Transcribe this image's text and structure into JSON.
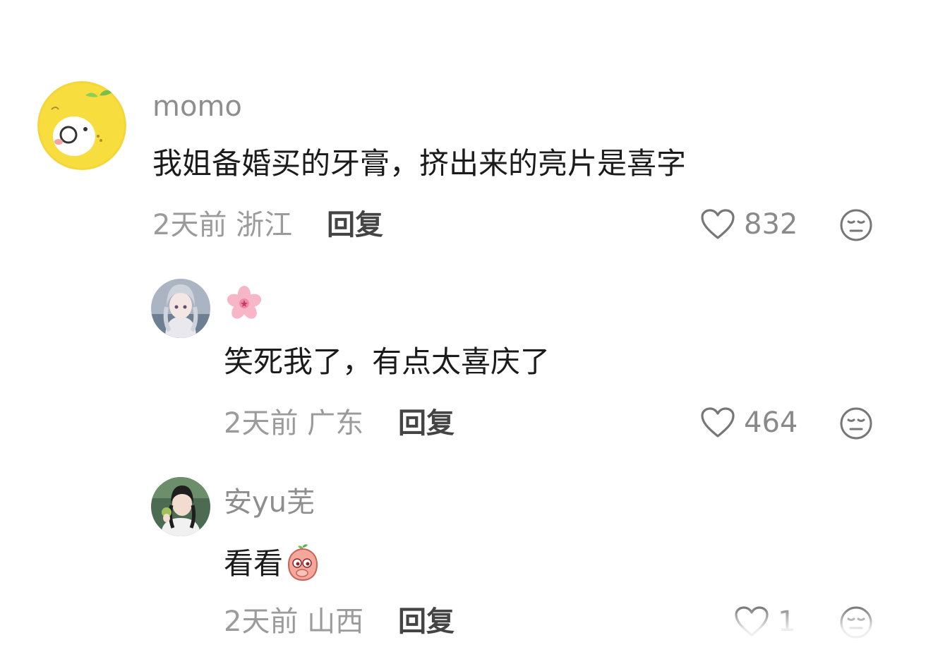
{
  "comments": [
    {
      "username": "momo",
      "text": "我姐备婚买的牙膏，挤出来的亮片是喜字",
      "time": "2天前",
      "location": "浙江",
      "reply_label": "回复",
      "likes": "832",
      "avatar_icon": "yellow-cartoon-avatar"
    },
    {
      "username_emoji": "cherry-blossom-emoji",
      "text": "笑死我了，有点太喜庆了",
      "time": "2天前",
      "location": "广东",
      "reply_label": "回复",
      "likes": "464",
      "avatar_icon": "anime-girl-avatar"
    },
    {
      "username": "安yu芜",
      "text": "看看",
      "text_emoji": "peach-face-emoji",
      "time": "2天前",
      "location": "山西",
      "reply_label": "回复",
      "likes": "1",
      "avatar_icon": "girl-photo-avatar"
    }
  ],
  "colors": {
    "username": "#8e8e8e",
    "meta": "#9b9b9b",
    "reply": "#444444",
    "content": "#1b1b1b"
  }
}
